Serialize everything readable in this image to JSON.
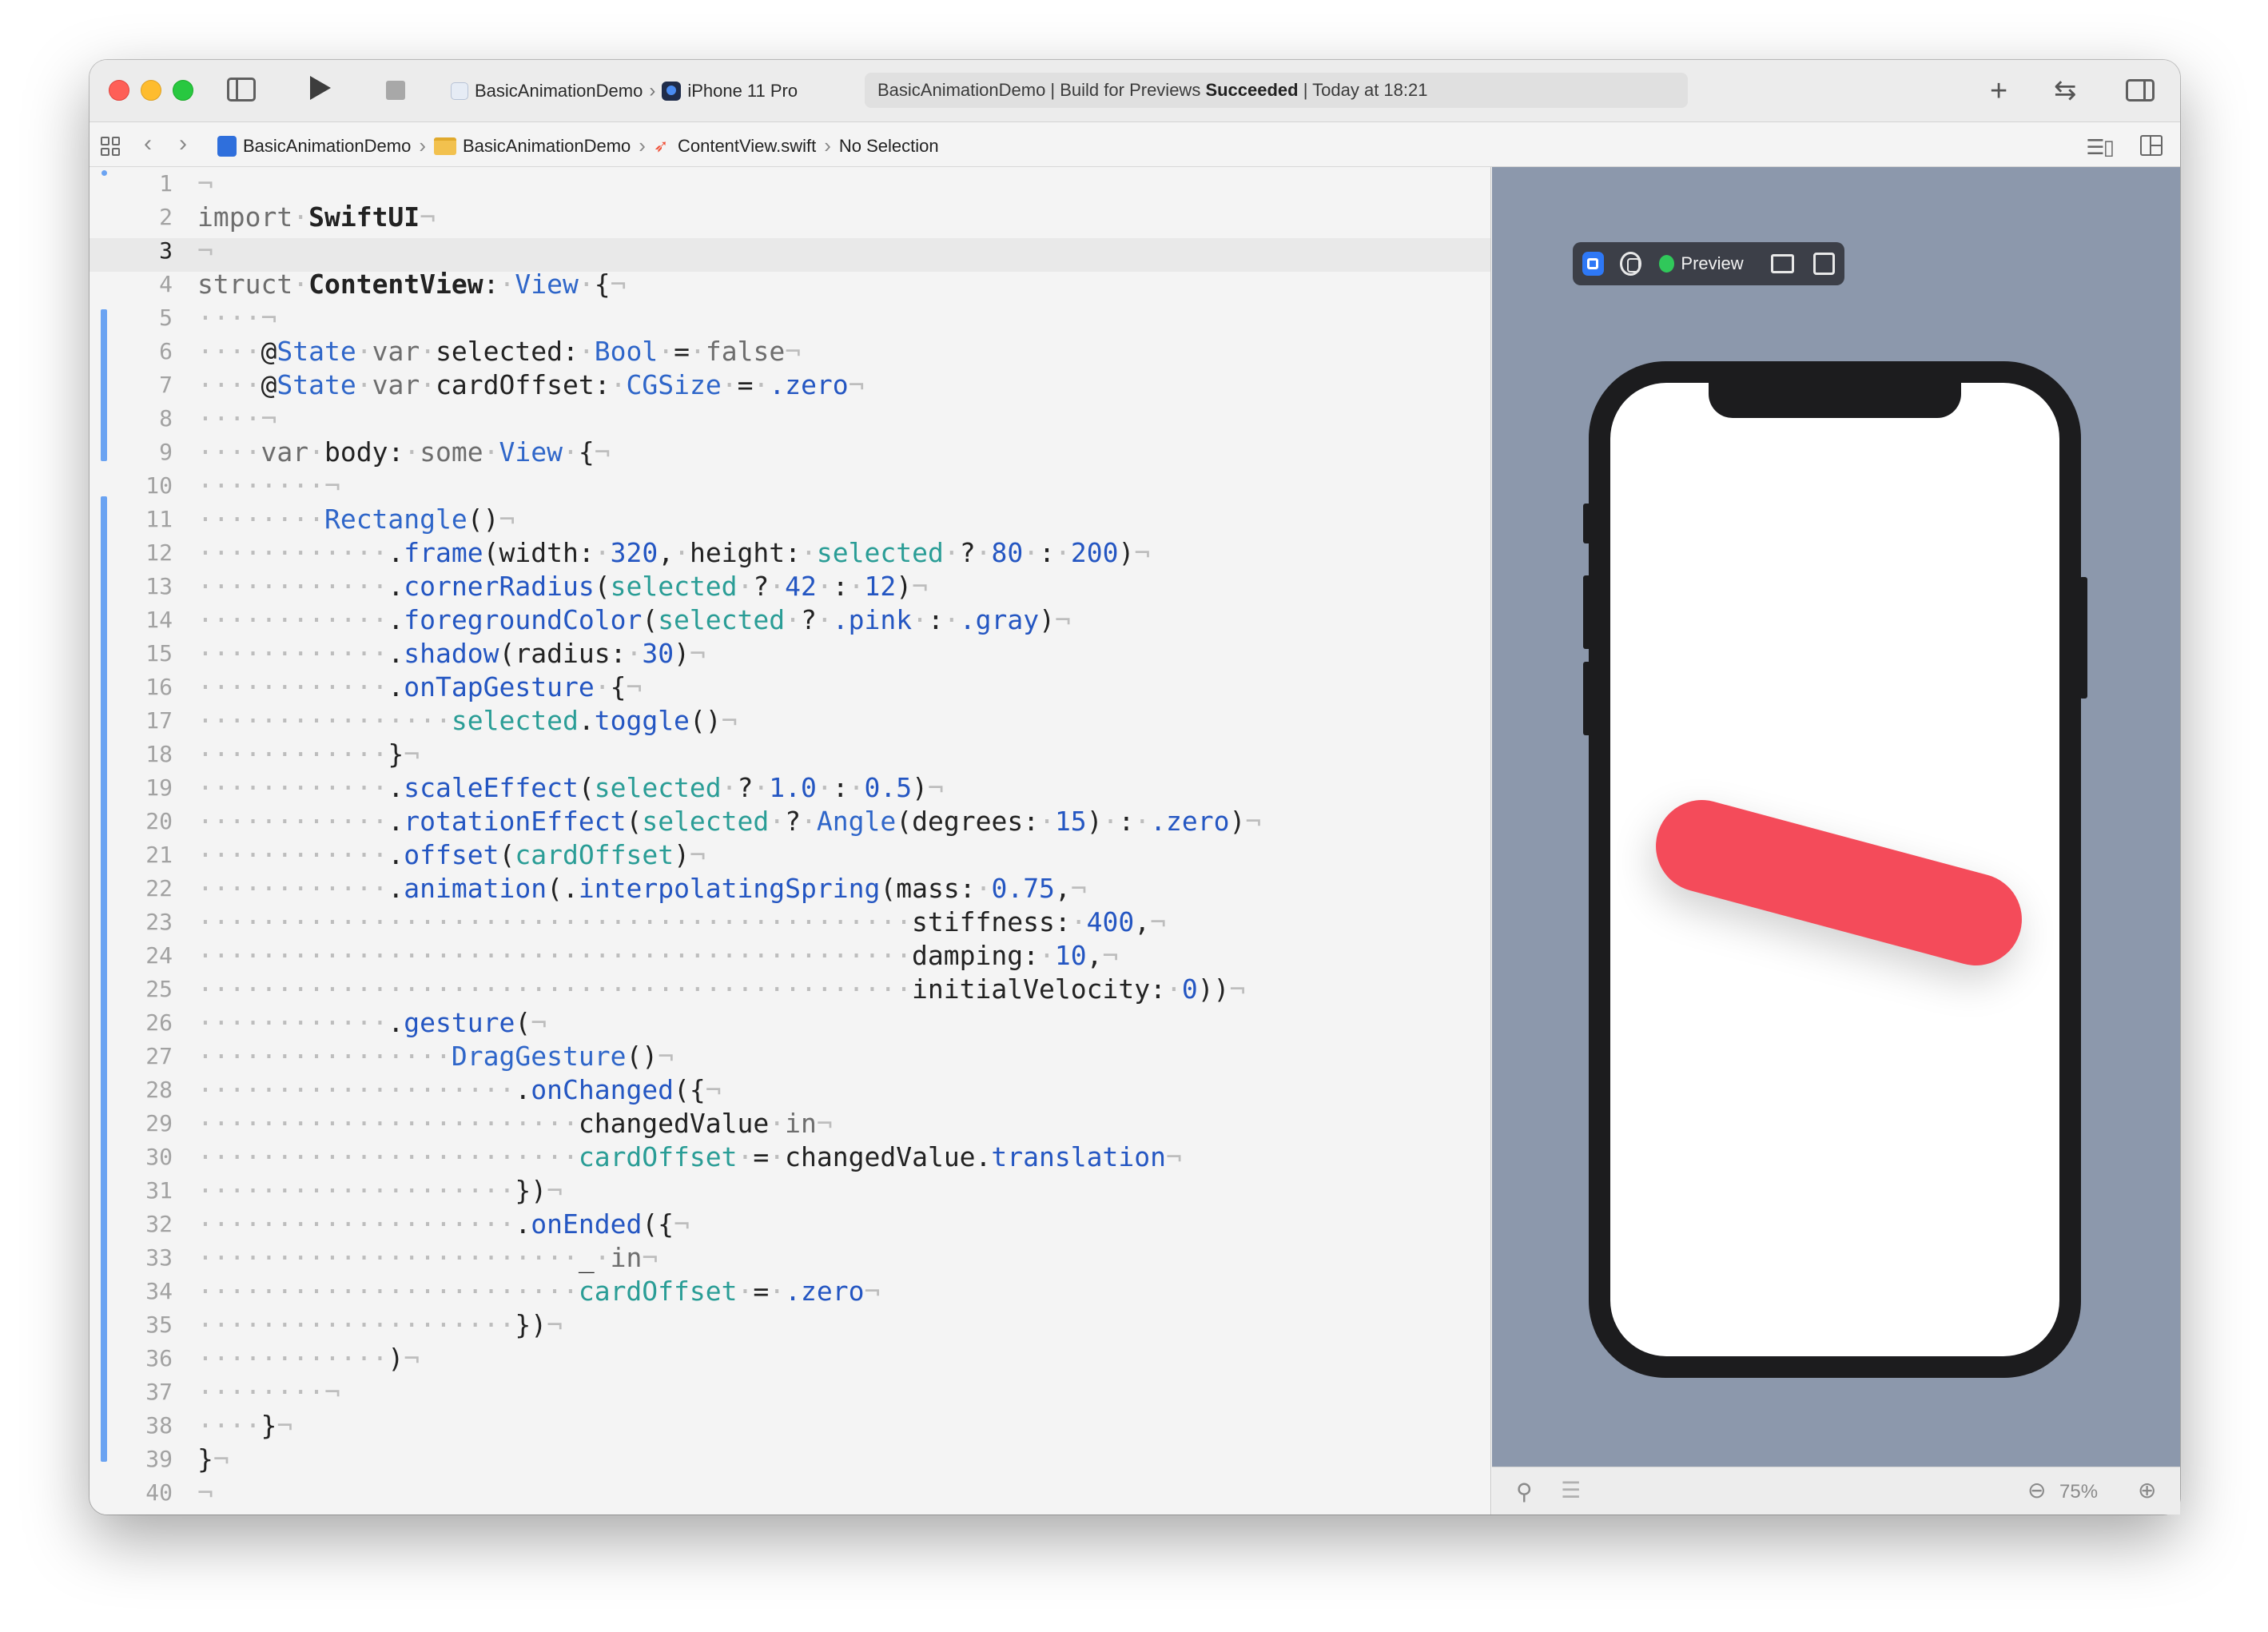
{
  "toolbar": {
    "scheme_target": "BasicAnimationDemo",
    "scheme_device": "iPhone 11 Pro",
    "activity_prefix": "BasicAnimationDemo | Build for Previews ",
    "activity_status": "Succeeded",
    "activity_suffix": " | Today at 18:21"
  },
  "jumpbar": {
    "crumbs": [
      "BasicAnimationDemo",
      "BasicAnimationDemo",
      "ContentView.swift",
      "No Selection"
    ]
  },
  "editor": {
    "line_numbers": [
      "1",
      "2",
      "3",
      "4",
      "5",
      "6",
      "7",
      "8",
      "9",
      "10",
      "11",
      "12",
      "13",
      "14",
      "15",
      "16",
      "17",
      "18",
      "19",
      "20",
      "21",
      "22",
      "23",
      "24",
      "25",
      "26",
      "27",
      "28",
      "29",
      "30",
      "31",
      "32",
      "33",
      "34",
      "35",
      "36",
      "37",
      "38",
      "39",
      "40"
    ],
    "current_line": 3,
    "code_lines": [
      [
        [
          "ws",
          "¬"
        ]
      ],
      [
        [
          "kw",
          "import"
        ],
        [
          "ws",
          "·"
        ],
        [
          "bo",
          "SwiftUI"
        ],
        [
          "ws",
          "¬"
        ]
      ],
      [
        [
          "ws",
          "¬"
        ]
      ],
      [
        [
          "kw",
          "struct"
        ],
        [
          "ws",
          "·"
        ],
        [
          "bo",
          "ContentView"
        ],
        [
          "",
          ":"
        ],
        [
          "ws",
          "·"
        ],
        [
          "ty",
          "View"
        ],
        [
          "ws",
          "·"
        ],
        [
          "",
          "{"
        ],
        [
          "ws",
          "¬"
        ]
      ],
      [
        [
          "ws",
          "····¬"
        ]
      ],
      [
        [
          "ws",
          "····"
        ],
        [
          "",
          "@"
        ],
        [
          "ty",
          "State"
        ],
        [
          "ws",
          "·"
        ],
        [
          "kw",
          "var"
        ],
        [
          "ws",
          "·"
        ],
        [
          "",
          "selected:"
        ],
        [
          "ws",
          "·"
        ],
        [
          "ty",
          "Bool"
        ],
        [
          "ws",
          "·"
        ],
        [
          "",
          "="
        ],
        [
          "ws",
          "·"
        ],
        [
          "kw",
          "false"
        ],
        [
          "ws",
          "¬"
        ]
      ],
      [
        [
          "ws",
          "····"
        ],
        [
          "",
          "@"
        ],
        [
          "ty",
          "State"
        ],
        [
          "ws",
          "·"
        ],
        [
          "kw",
          "var"
        ],
        [
          "ws",
          "·"
        ],
        [
          "",
          "cardOffset:"
        ],
        [
          "ws",
          "·"
        ],
        [
          "ty",
          "CGSize"
        ],
        [
          "ws",
          "·"
        ],
        [
          "",
          "="
        ],
        [
          "ws",
          "·"
        ],
        [
          "me",
          ".zero"
        ],
        [
          "ws",
          "¬"
        ]
      ],
      [
        [
          "ws",
          "····¬"
        ]
      ],
      [
        [
          "ws",
          "····"
        ],
        [
          "kw",
          "var"
        ],
        [
          "ws",
          "·"
        ],
        [
          "",
          "body:"
        ],
        [
          "ws",
          "·"
        ],
        [
          "kw",
          "some"
        ],
        [
          "ws",
          "·"
        ],
        [
          "ty",
          "View"
        ],
        [
          "ws",
          "·"
        ],
        [
          "",
          "{"
        ],
        [
          "ws",
          "¬"
        ]
      ],
      [
        [
          "ws",
          "········¬"
        ]
      ],
      [
        [
          "ws",
          "········"
        ],
        [
          "ty",
          "Rectangle"
        ],
        [
          "",
          "()"
        ],
        [
          "ws",
          "¬"
        ]
      ],
      [
        [
          "ws",
          "············"
        ],
        [
          "",
          "."
        ],
        [
          "me",
          "frame"
        ],
        [
          "",
          "(width:"
        ],
        [
          "ws",
          "·"
        ],
        [
          "nu",
          "320"
        ],
        [
          "",
          ","
        ],
        [
          "ws",
          "·"
        ],
        [
          "",
          "height:"
        ],
        [
          "ws",
          "·"
        ],
        [
          "pr",
          "selected"
        ],
        [
          "ws",
          "·"
        ],
        [
          "",
          "?"
        ],
        [
          "ws",
          "·"
        ],
        [
          "nu",
          "80"
        ],
        [
          "ws",
          "·"
        ],
        [
          "",
          ":"
        ],
        [
          "ws",
          "·"
        ],
        [
          "nu",
          "200"
        ],
        [
          "",
          ")"
        ],
        [
          "ws",
          "¬"
        ]
      ],
      [
        [
          "ws",
          "············"
        ],
        [
          "",
          "."
        ],
        [
          "me",
          "cornerRadius"
        ],
        [
          "",
          "("
        ],
        [
          "pr",
          "selected"
        ],
        [
          "ws",
          "·"
        ],
        [
          "",
          "?"
        ],
        [
          "ws",
          "·"
        ],
        [
          "nu",
          "42"
        ],
        [
          "ws",
          "·"
        ],
        [
          "",
          ":"
        ],
        [
          "ws",
          "·"
        ],
        [
          "nu",
          "12"
        ],
        [
          "",
          ")"
        ],
        [
          "ws",
          "¬"
        ]
      ],
      [
        [
          "ws",
          "············"
        ],
        [
          "",
          "."
        ],
        [
          "me",
          "foregroundColor"
        ],
        [
          "",
          "("
        ],
        [
          "pr",
          "selected"
        ],
        [
          "ws",
          "·"
        ],
        [
          "",
          "?"
        ],
        [
          "ws",
          "·"
        ],
        [
          "me",
          ".pink"
        ],
        [
          "ws",
          "·"
        ],
        [
          "",
          ":"
        ],
        [
          "ws",
          "·"
        ],
        [
          "me",
          ".gray"
        ],
        [
          "",
          ")"
        ],
        [
          "ws",
          "¬"
        ]
      ],
      [
        [
          "ws",
          "············"
        ],
        [
          "",
          "."
        ],
        [
          "me",
          "shadow"
        ],
        [
          "",
          "(radius:"
        ],
        [
          "ws",
          "·"
        ],
        [
          "nu",
          "30"
        ],
        [
          "",
          ")"
        ],
        [
          "ws",
          "¬"
        ]
      ],
      [
        [
          "ws",
          "············"
        ],
        [
          "",
          "."
        ],
        [
          "me",
          "onTapGesture"
        ],
        [
          "ws",
          "·"
        ],
        [
          "",
          "{"
        ],
        [
          "ws",
          "¬"
        ]
      ],
      [
        [
          "ws",
          "················"
        ],
        [
          "pr",
          "selected"
        ],
        [
          "",
          "."
        ],
        [
          "me",
          "toggle"
        ],
        [
          "",
          "()"
        ],
        [
          "ws",
          "¬"
        ]
      ],
      [
        [
          "ws",
          "············"
        ],
        [
          "",
          "}"
        ],
        [
          "ws",
          "¬"
        ]
      ],
      [
        [
          "ws",
          "············"
        ],
        [
          "",
          "."
        ],
        [
          "me",
          "scaleEffect"
        ],
        [
          "",
          "("
        ],
        [
          "pr",
          "selected"
        ],
        [
          "ws",
          "·"
        ],
        [
          "",
          "?"
        ],
        [
          "ws",
          "·"
        ],
        [
          "nu",
          "1.0"
        ],
        [
          "ws",
          "·"
        ],
        [
          "",
          ":"
        ],
        [
          "ws",
          "·"
        ],
        [
          "nu",
          "0.5"
        ],
        [
          "",
          ")"
        ],
        [
          "ws",
          "¬"
        ]
      ],
      [
        [
          "ws",
          "············"
        ],
        [
          "",
          "."
        ],
        [
          "me",
          "rotationEffect"
        ],
        [
          "",
          "("
        ],
        [
          "pr",
          "selected"
        ],
        [
          "ws",
          "·"
        ],
        [
          "",
          "?"
        ],
        [
          "ws",
          "·"
        ],
        [
          "ty",
          "Angle"
        ],
        [
          "",
          "(degrees:"
        ],
        [
          "ws",
          "·"
        ],
        [
          "nu",
          "15"
        ],
        [
          "",
          ")"
        ],
        [
          "ws",
          "·"
        ],
        [
          "",
          ":"
        ],
        [
          "ws",
          "·"
        ],
        [
          "me",
          ".zero"
        ],
        [
          "",
          ")"
        ],
        [
          "ws",
          "¬"
        ]
      ],
      [
        [
          "ws",
          "············"
        ],
        [
          "",
          "."
        ],
        [
          "me",
          "offset"
        ],
        [
          "",
          "("
        ],
        [
          "pr",
          "cardOffset"
        ],
        [
          "",
          ")"
        ],
        [
          "ws",
          "¬"
        ]
      ],
      [
        [
          "ws",
          "············"
        ],
        [
          "",
          "."
        ],
        [
          "me",
          "animation"
        ],
        [
          "",
          "(."
        ],
        [
          "me",
          "interpolatingSpring"
        ],
        [
          "",
          "(mass:"
        ],
        [
          "ws",
          "·"
        ],
        [
          "nu",
          "0.75"
        ],
        [
          "",
          ","
        ],
        [
          "ws",
          "¬"
        ]
      ],
      [
        [
          "ws",
          "·············································"
        ],
        [
          "",
          "stiffness:"
        ],
        [
          "ws",
          "·"
        ],
        [
          "nu",
          "400"
        ],
        [
          "",
          ","
        ],
        [
          "ws",
          "¬"
        ]
      ],
      [
        [
          "ws",
          "·············································"
        ],
        [
          "",
          "damping:"
        ],
        [
          "ws",
          "·"
        ],
        [
          "nu",
          "10"
        ],
        [
          "",
          ","
        ],
        [
          "ws",
          "¬"
        ]
      ],
      [
        [
          "ws",
          "·············································"
        ],
        [
          "",
          "initialVelocity:"
        ],
        [
          "ws",
          "·"
        ],
        [
          "nu",
          "0"
        ],
        [
          "",
          "))"
        ],
        [
          "ws",
          "¬"
        ]
      ],
      [
        [
          "ws",
          "············"
        ],
        [
          "",
          "."
        ],
        [
          "me",
          "gesture"
        ],
        [
          "",
          "("
        ],
        [
          "ws",
          "¬"
        ]
      ],
      [
        [
          "ws",
          "················"
        ],
        [
          "ty",
          "DragGesture"
        ],
        [
          "",
          "()"
        ],
        [
          "ws",
          "¬"
        ]
      ],
      [
        [
          "ws",
          "····················"
        ],
        [
          "",
          "."
        ],
        [
          "me",
          "onChanged"
        ],
        [
          "",
          "({"
        ],
        [
          "ws",
          "¬"
        ]
      ],
      [
        [
          "ws",
          "························"
        ],
        [
          "",
          "changedValue"
        ],
        [
          "ws",
          "·"
        ],
        [
          "kw",
          "in"
        ],
        [
          "ws",
          "¬"
        ]
      ],
      [
        [
          "ws",
          "························"
        ],
        [
          "pr",
          "cardOffset"
        ],
        [
          "ws",
          "·"
        ],
        [
          "",
          "="
        ],
        [
          "ws",
          "·"
        ],
        [
          "",
          "changedValue."
        ],
        [
          "me",
          "translation"
        ],
        [
          "ws",
          "¬"
        ]
      ],
      [
        [
          "ws",
          "····················"
        ],
        [
          "",
          "})"
        ],
        [
          "ws",
          "¬"
        ]
      ],
      [
        [
          "ws",
          "····················"
        ],
        [
          "",
          "."
        ],
        [
          "me",
          "onEnded"
        ],
        [
          "",
          "({"
        ],
        [
          "ws",
          "¬"
        ]
      ],
      [
        [
          "ws",
          "························"
        ],
        [
          "",
          "_"
        ],
        [
          "ws",
          "·"
        ],
        [
          "kw",
          "in"
        ],
        [
          "ws",
          "¬"
        ]
      ],
      [
        [
          "ws",
          "························"
        ],
        [
          "pr",
          "cardOffset"
        ],
        [
          "ws",
          "·"
        ],
        [
          "",
          "="
        ],
        [
          "ws",
          "·"
        ],
        [
          "me",
          ".zero"
        ],
        [
          "ws",
          "¬"
        ]
      ],
      [
        [
          "ws",
          "····················"
        ],
        [
          "",
          "})"
        ],
        [
          "ws",
          "¬"
        ]
      ],
      [
        [
          "ws",
          "············"
        ],
        [
          "",
          ")"
        ],
        [
          "ws",
          "¬"
        ]
      ],
      [
        [
          "ws",
          "········¬"
        ]
      ],
      [
        [
          "ws",
          "····"
        ],
        [
          "",
          "}"
        ],
        [
          "ws",
          "¬"
        ]
      ],
      [
        [
          "",
          "}"
        ],
        [
          "ws",
          "¬"
        ]
      ],
      [
        [
          "ws",
          "¬"
        ]
      ]
    ]
  },
  "preview": {
    "label": "Preview",
    "card_rotation_degrees": 15,
    "card_color": "#f44b5a"
  },
  "statusbar": {
    "zoom": "75%"
  },
  "colors": {
    "accent": "#2e78f6",
    "live_dot": "#30c85a",
    "change_bar": "#6aa3f2"
  }
}
